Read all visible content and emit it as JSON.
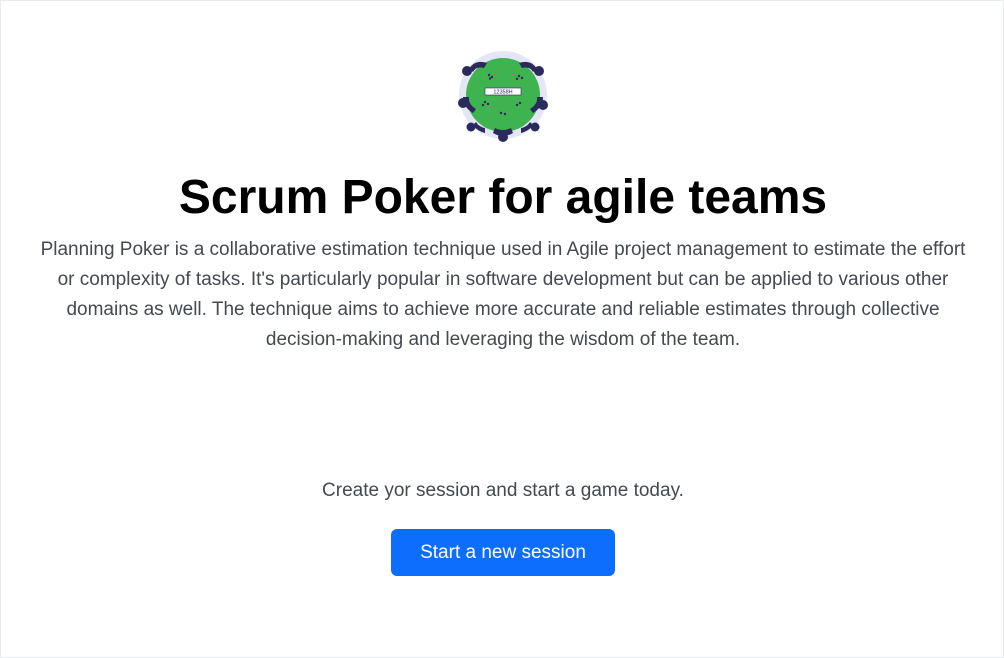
{
  "hero": {
    "logo_icon": "poker-table-icon",
    "logo_card_text": "12358H",
    "title": "Scrum Poker for agile teams",
    "description": "Planning Poker is a collaborative estimation technique used in Agile project management to estimate the effort or complexity of tasks. It's particularly popular in software development but can be applied to various other domains as well. The technique aims to achieve more accurate and reliable estimates through collective decision-making and leveraging the wisdom of the team."
  },
  "cta": {
    "text": "Create yor session and start a game today.",
    "button_label": "Start a new session"
  },
  "colors": {
    "accent": "#0d6efd",
    "table_green": "#3fb34f",
    "player_navy": "#2b2a5c",
    "halo": "#e4e5f7"
  }
}
